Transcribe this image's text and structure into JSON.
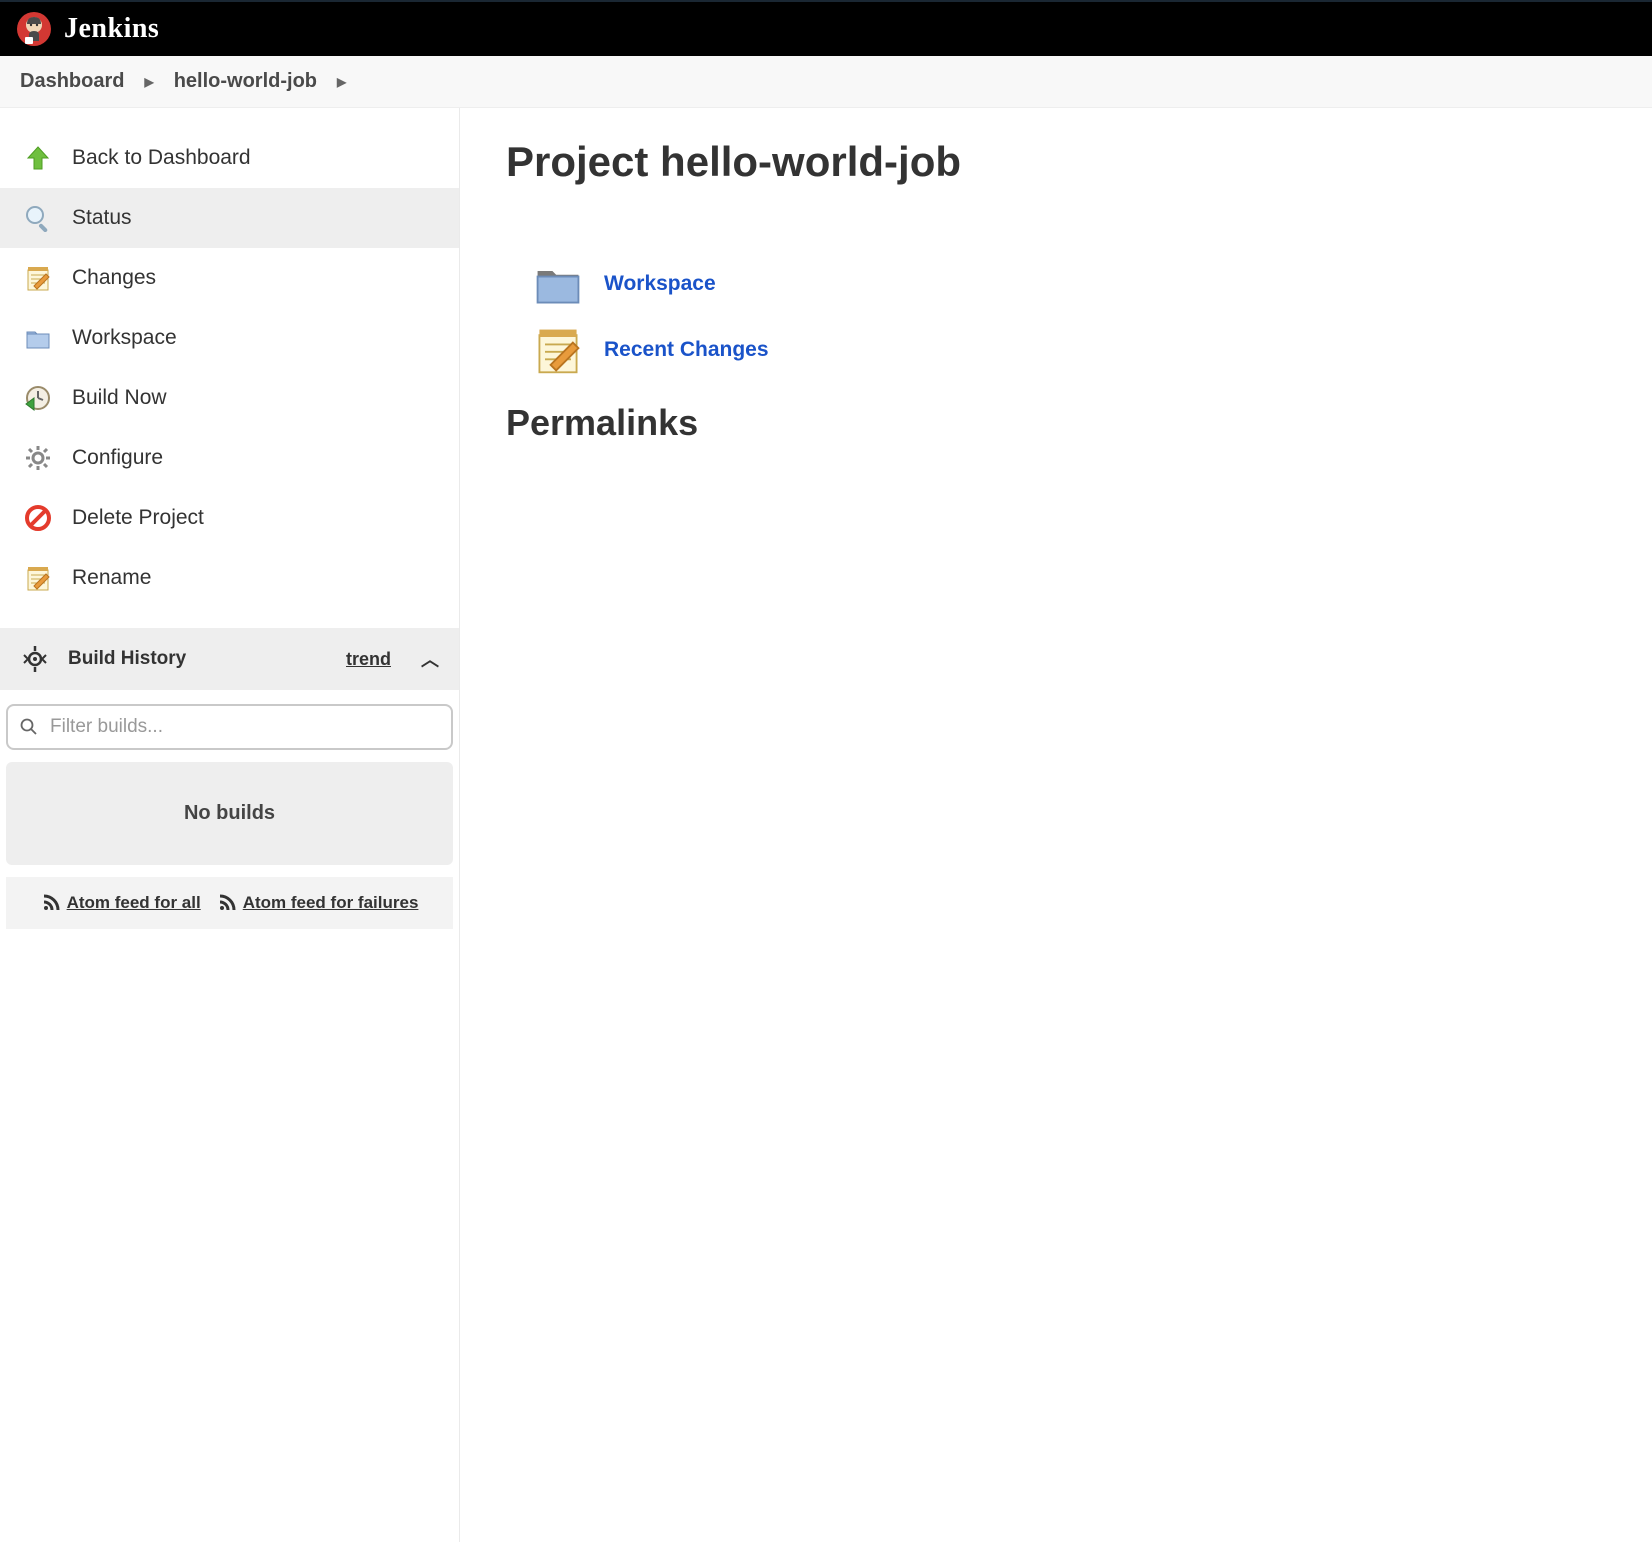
{
  "header": {
    "brand": "Jenkins"
  },
  "breadcrumbs": {
    "dashboard": "Dashboard",
    "job": "hello-world-job"
  },
  "sidebar": {
    "back": "Back to Dashboard",
    "status": "Status",
    "changes": "Changes",
    "workspace": "Workspace",
    "build_now": "Build Now",
    "configure": "Configure",
    "delete": "Delete Project",
    "rename": "Rename"
  },
  "build_history": {
    "title": "Build History",
    "trend": "trend",
    "filter_placeholder": "Filter builds...",
    "no_builds": "No builds",
    "feed_all": "Atom feed for all",
    "feed_failures": "Atom feed for failures"
  },
  "main": {
    "title": "Project hello-world-job",
    "workspace": "Workspace",
    "recent_changes": "Recent Changes",
    "permalinks": "Permalinks"
  }
}
